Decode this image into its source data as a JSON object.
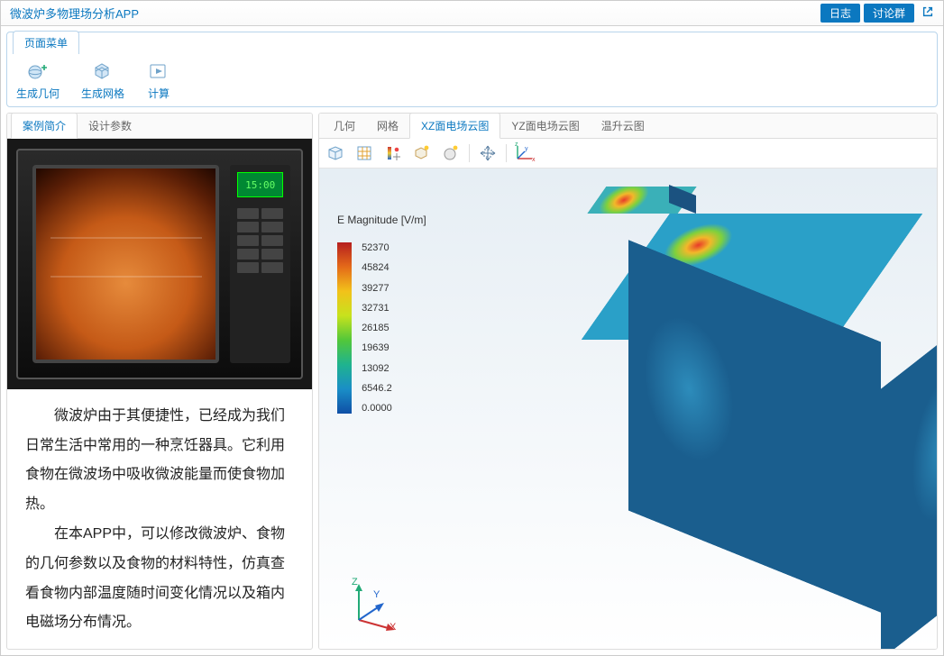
{
  "header": {
    "title": "微波炉多物理场分析APP",
    "btn_log": "日志",
    "btn_discuss": "讨论群"
  },
  "ribbon": {
    "tab_label": "页面菜单",
    "items": [
      "生成几何",
      "生成网格",
      "计算"
    ]
  },
  "left": {
    "tabs": {
      "intro": "案例简介",
      "params": "设计参数"
    },
    "microwave_display": "15:00",
    "paragraph1": "微波炉由于其便捷性，已经成为我们日常生活中常用的一种烹饪器具。它利用食物在微波场中吸收微波能量而使食物加热。",
    "paragraph2": "在本APP中，可以修改微波炉、食物的几何参数以及食物的材料特性，仿真查看食物内部温度随时间变化情况以及箱内电磁场分布情况。"
  },
  "right": {
    "tabs": {
      "geom": "几何",
      "mesh": "网格",
      "xz": "XZ面电场云图",
      "yz": "YZ面电场云图",
      "temp": "温升云图"
    },
    "legend_title": "E Magnitude [V/m]",
    "legend_ticks": [
      "52370",
      "45824",
      "39277",
      "32731",
      "26185",
      "19639",
      "13092",
      "6546.2",
      "0.0000"
    ],
    "triad": {
      "x": "X",
      "y": "Y",
      "z": "Z"
    }
  }
}
